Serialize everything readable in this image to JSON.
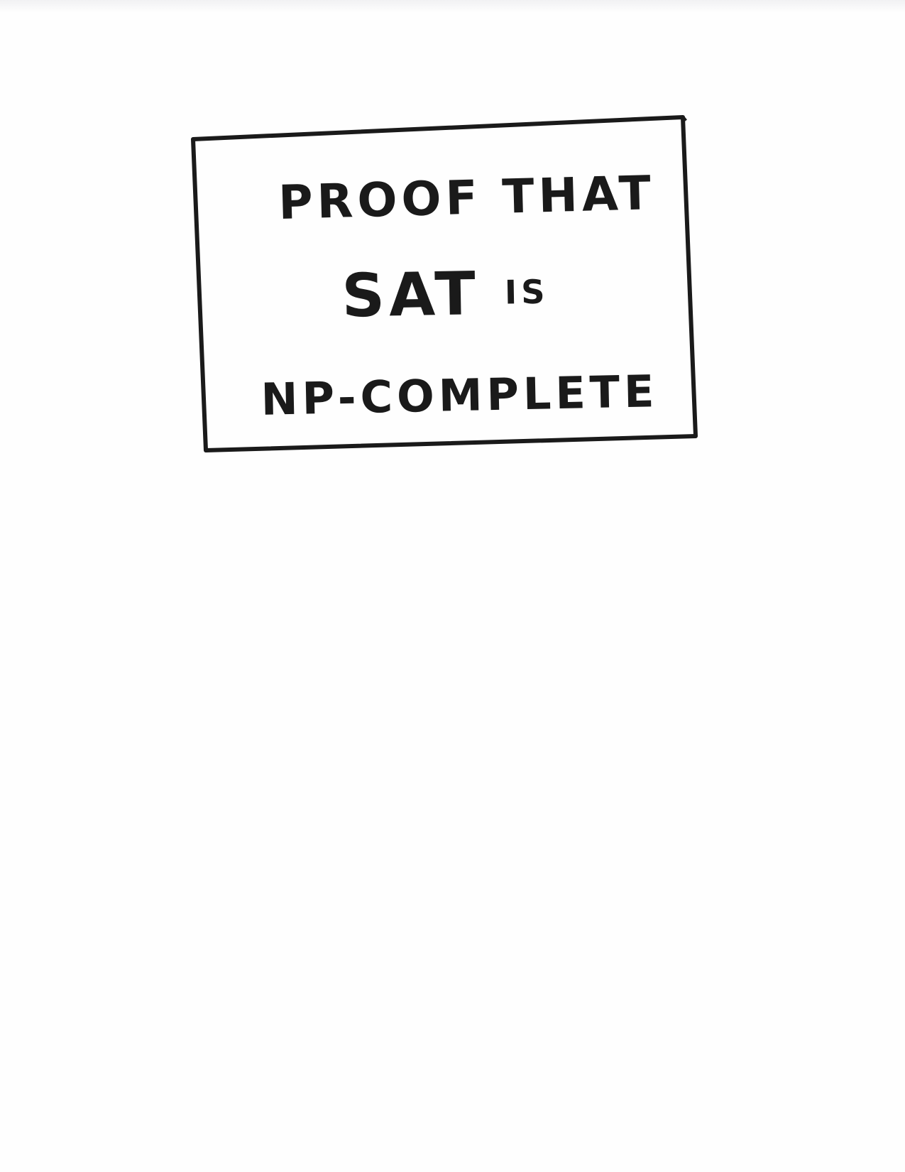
{
  "title": {
    "line1": "PROOF THAT",
    "line2_main": "SAT",
    "line2_suffix": "IS",
    "line3": "NP-COMPLETE"
  }
}
